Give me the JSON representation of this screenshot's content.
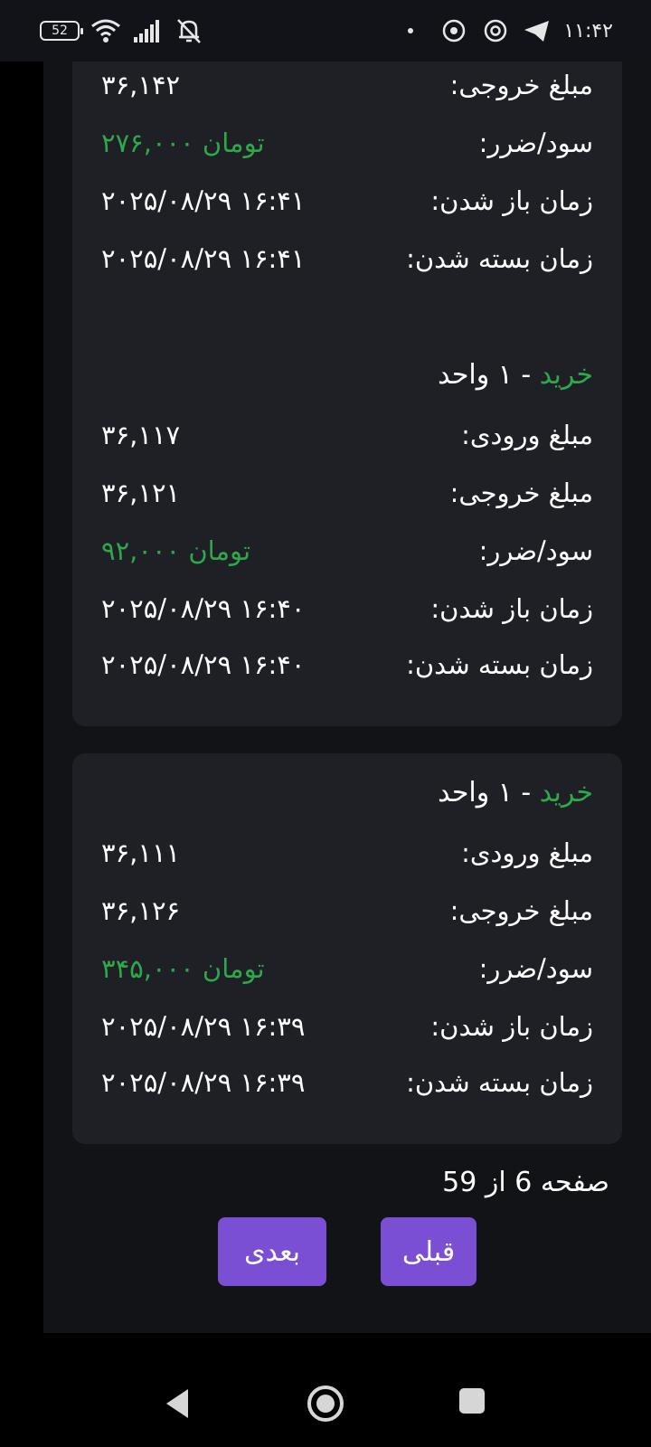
{
  "status_bar": {
    "battery": "52",
    "clock": "۱۱:۴۲"
  },
  "cards": [
    {
      "title_side": "",
      "title_rest": "",
      "rows": [
        {
          "label": "مبلغ خروجی:",
          "value": "۳۶,۱۴۲",
          "green": false
        },
        {
          "label": "سود/ضرر:",
          "value": "۲۷۶,۰۰۰ تومان",
          "green": true
        },
        {
          "label": "زمان باز شدن:",
          "value": "۲۰۲۵/۰۸/۲۹ ۱۶:۴۱",
          "green": false
        },
        {
          "label": "زمان بسته شدن:",
          "value": "۲۰۲۵/۰۸/۲۹ ۱۶:۴۱",
          "green": false
        }
      ]
    },
    {
      "title_side": "خرید",
      "title_rest": " - ۱ واحد",
      "rows": [
        {
          "label": "مبلغ ورودی:",
          "value": "۳۶,۱۱۷",
          "green": false
        },
        {
          "label": "مبلغ خروجی:",
          "value": "۳۶,۱۲۱",
          "green": false
        },
        {
          "label": "سود/ضرر:",
          "value": "۹۲,۰۰۰ تومان",
          "green": true
        },
        {
          "label": "زمان باز شدن:",
          "value": "۲۰۲۵/۰۸/۲۹ ۱۶:۴۰",
          "green": false
        },
        {
          "label": "زمان بسته شدن:",
          "value": "۲۰۲۵/۰۸/۲۹ ۱۶:۴۰",
          "green": false
        }
      ]
    },
    {
      "title_side": "خرید",
      "title_rest": " - ۱ واحد",
      "rows": [
        {
          "label": "مبلغ ورودی:",
          "value": "۳۶,۱۱۱",
          "green": false
        },
        {
          "label": "مبلغ خروجی:",
          "value": "۳۶,۱۲۶",
          "green": false
        },
        {
          "label": "سود/ضرر:",
          "value": "۳۴۵,۰۰۰ تومان",
          "green": true
        },
        {
          "label": "زمان باز شدن:",
          "value": "۲۰۲۵/۰۸/۲۹ ۱۶:۳۹",
          "green": false
        },
        {
          "label": "زمان بسته شدن:",
          "value": "۲۰۲۵/۰۸/۲۹ ۱۶:۳۹",
          "green": false
        }
      ]
    }
  ],
  "pagination": {
    "page_info": "صفحه 6 از 59",
    "next_label": "بعدی",
    "prev_label": "قبلی"
  },
  "colors": {
    "profit_green": "#2ea84a",
    "button_purple": "#7a4fd4",
    "card_bg": "#1f2026"
  }
}
